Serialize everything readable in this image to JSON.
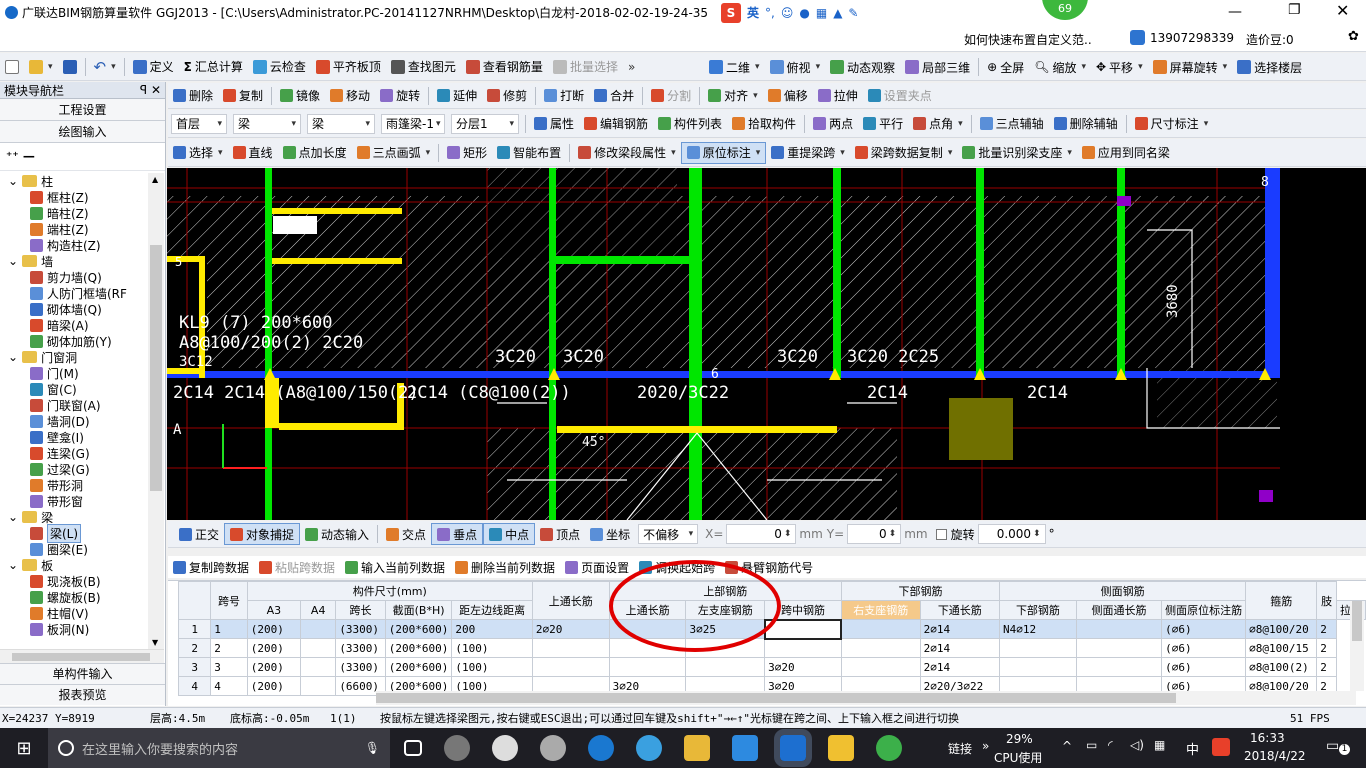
{
  "title_bar": {
    "app_title": "广联达BIM钢筋算量软件 GGJ2013 - [C:\\Users\\Administrator.PC-20141127NRHM\\Desktop\\白龙村-2018-02-02-19-24-35",
    "ime_label": "英",
    "badge_count": "69",
    "help_link": "如何快速布置自定义范..",
    "phone": "13907298339",
    "coins": "造价豆:0"
  },
  "toolbar1": {
    "items": [
      "定义",
      "汇总计算",
      "云检查",
      "平齐板顶",
      "查找图元",
      "查看钢筋量",
      "批量选择"
    ],
    "right_items": [
      "二维",
      "俯视",
      "动态观察",
      "局部三维",
      "全屏",
      "缩放",
      "平移",
      "屏幕旋转",
      "选择楼层"
    ]
  },
  "toolbar2": {
    "items": [
      "删除",
      "复制",
      "镜像",
      "移动",
      "旋转",
      "延伸",
      "修剪",
      "打断",
      "合并",
      "分割",
      "对齐",
      "偏移",
      "拉伸",
      "设置夹点"
    ]
  },
  "toolbar3": {
    "floor": "首层",
    "cat": "梁",
    "type": "梁",
    "member": "雨篷梁-1",
    "layer": "分层1",
    "items": [
      "属性",
      "编辑钢筋",
      "构件列表",
      "拾取构件",
      "两点",
      "平行",
      "点角",
      "三点辅轴",
      "删除辅轴",
      "尺寸标注"
    ]
  },
  "toolbar4": {
    "items": [
      "选择",
      "直线",
      "点加长度",
      "三点画弧",
      "矩形",
      "智能布置",
      "修改梁段属性",
      "原位标注",
      "重提梁跨",
      "梁跨数据复制",
      "批量识别梁支座",
      "应用到同名梁"
    ]
  },
  "nav": {
    "title": "模块导航栏",
    "pin": "ꟼ",
    "section_project": "工程设置",
    "section_draw": "绘图输入",
    "tree": [
      {
        "label": "柱",
        "level": 0
      },
      {
        "label": "框柱(Z)",
        "level": 1
      },
      {
        "label": "暗柱(Z)",
        "level": 1
      },
      {
        "label": "端柱(Z)",
        "level": 1
      },
      {
        "label": "构造柱(Z)",
        "level": 1
      },
      {
        "label": "墙",
        "level": 0
      },
      {
        "label": "剪力墙(Q)",
        "level": 1
      },
      {
        "label": "人防门框墙(RF",
        "level": 1
      },
      {
        "label": "砌体墙(Q)",
        "level": 1
      },
      {
        "label": "暗梁(A)",
        "level": 1
      },
      {
        "label": "砌体加筋(Y)",
        "level": 1
      },
      {
        "label": "门窗洞",
        "level": 0
      },
      {
        "label": "门(M)",
        "level": 1
      },
      {
        "label": "窗(C)",
        "level": 1
      },
      {
        "label": "门联窗(A)",
        "level": 1
      },
      {
        "label": "墙洞(D)",
        "level": 1
      },
      {
        "label": "壁龛(I)",
        "level": 1
      },
      {
        "label": "连梁(G)",
        "level": 1
      },
      {
        "label": "过梁(G)",
        "level": 1
      },
      {
        "label": "带形洞",
        "level": 1
      },
      {
        "label": "带形窗",
        "level": 1
      },
      {
        "label": "梁",
        "level": 0
      },
      {
        "label": "梁(L)",
        "level": 1
      },
      {
        "label": "圈梁(E)",
        "level": 1
      },
      {
        "label": "板",
        "level": 0
      },
      {
        "label": "现浇板(B)",
        "level": 1
      },
      {
        "label": "螺旋板(B)",
        "level": 1
      },
      {
        "label": "柱帽(V)",
        "level": 1
      },
      {
        "label": "板洞(N)",
        "level": 1
      }
    ],
    "bottom_single": "单构件输入",
    "bottom_report": "报表预览"
  },
  "canvas": {
    "labels": [
      "KL9 (7) 200*600",
      "A8@100/200(2) 2C20",
      "3C12",
      "2C14 2C14 (A8@100/150(2)",
      "2C14 (C8@100(2))",
      "3C20",
      "3C20",
      "2020/3C22",
      "3C20",
      "3C20 2C25",
      "2C14",
      "2C14",
      "3680",
      "45°",
      "A",
      "5",
      "6",
      "8"
    ]
  },
  "snap_bar": {
    "items": [
      "正交",
      "对象捕捉",
      "动态输入",
      "交点",
      "垂点",
      "中点",
      "顶点",
      "坐标"
    ],
    "offset_mode": "不偏移",
    "x_label": "X=",
    "x_value": "0",
    "y_label": "Y=",
    "y_value": "0",
    "unit": "mm",
    "rotate_label": "旋转",
    "rotate_value": "0.000",
    "deg": "°"
  },
  "grid_toolbar": {
    "items": [
      "复制跨数据",
      "粘贴跨数据",
      "输入当前列数据",
      "删除当前列数据",
      "页面设置",
      "调换起始跨",
      "悬臂钢筋代号"
    ]
  },
  "grid": {
    "group_headers": [
      "构件尺寸(mm)",
      "上部钢筋",
      "下部钢筋",
      "侧面钢筋"
    ],
    "headers": [
      "跨号",
      "A3",
      "A4",
      "跨长",
      "截面(B*H)",
      "距左边线距离",
      "上通长筋",
      "左支座钢筋",
      "跨中钢筋",
      "右支座钢筋",
      "下通长筋",
      "下部钢筋",
      "侧面通长筋",
      "侧面原位标注筋",
      "拉筋",
      "箍筋",
      "肢"
    ],
    "rows": [
      [
        "1",
        "1",
        "(200)",
        "",
        "(3300)",
        "(200*600)",
        "200",
        "2⌀20",
        "",
        "3⌀25",
        "",
        "",
        "2⌀14",
        "N4⌀12",
        "",
        "(⌀6)",
        "⌀8@100/20",
        "2"
      ],
      [
        "2",
        "2",
        "(200)",
        "",
        "(3300)",
        "(200*600)",
        "(100)",
        "",
        "",
        "",
        "",
        "",
        "2⌀14",
        "",
        "",
        "(⌀6)",
        "⌀8@100/15",
        "2"
      ],
      [
        "3",
        "3",
        "(200)",
        "",
        "(3300)",
        "(200*600)",
        "(100)",
        "",
        "",
        "",
        "3⌀20",
        "",
        "2⌀14",
        "",
        "",
        "(⌀6)",
        "⌀8@100(2)",
        "2"
      ],
      [
        "4",
        "4",
        "(200)",
        "",
        "(6600)",
        "(200*600)",
        "(100)",
        "",
        "3⌀20",
        "",
        "3⌀20",
        "",
        "2⌀20/3⌀22",
        "",
        "",
        "(⌀6)",
        "⌀8@100/20",
        "2"
      ]
    ]
  },
  "status_bar": {
    "coords": "X=24237 Y=8919",
    "floor_h": "层高:4.5m",
    "bottom_h": "底标高:-0.05m",
    "count": "1(1)",
    "hint": "按鼠标左键选择梁图元,按右键或ESC退出;可以通过回车键及shift+\"→←↑\"光标键在跨之间、上下输入框之间进行切换",
    "fps": "51 FPS"
  },
  "taskbar": {
    "search_placeholder": "在这里输入你要搜索的内容",
    "link": "链接",
    "cpu_pct": "29%",
    "cpu_label": "CPU使用",
    "lang": "中",
    "time": "16:33",
    "date": "2018/4/22",
    "notif": "1"
  },
  "colors": {
    "canvas_bg": "#000000",
    "beam_green": "#00e600",
    "beam_yellow": "#ffeb00",
    "axis_blue": "#1a3cff",
    "grid_red": "#b00000",
    "highlight_circle": "#e00000"
  }
}
